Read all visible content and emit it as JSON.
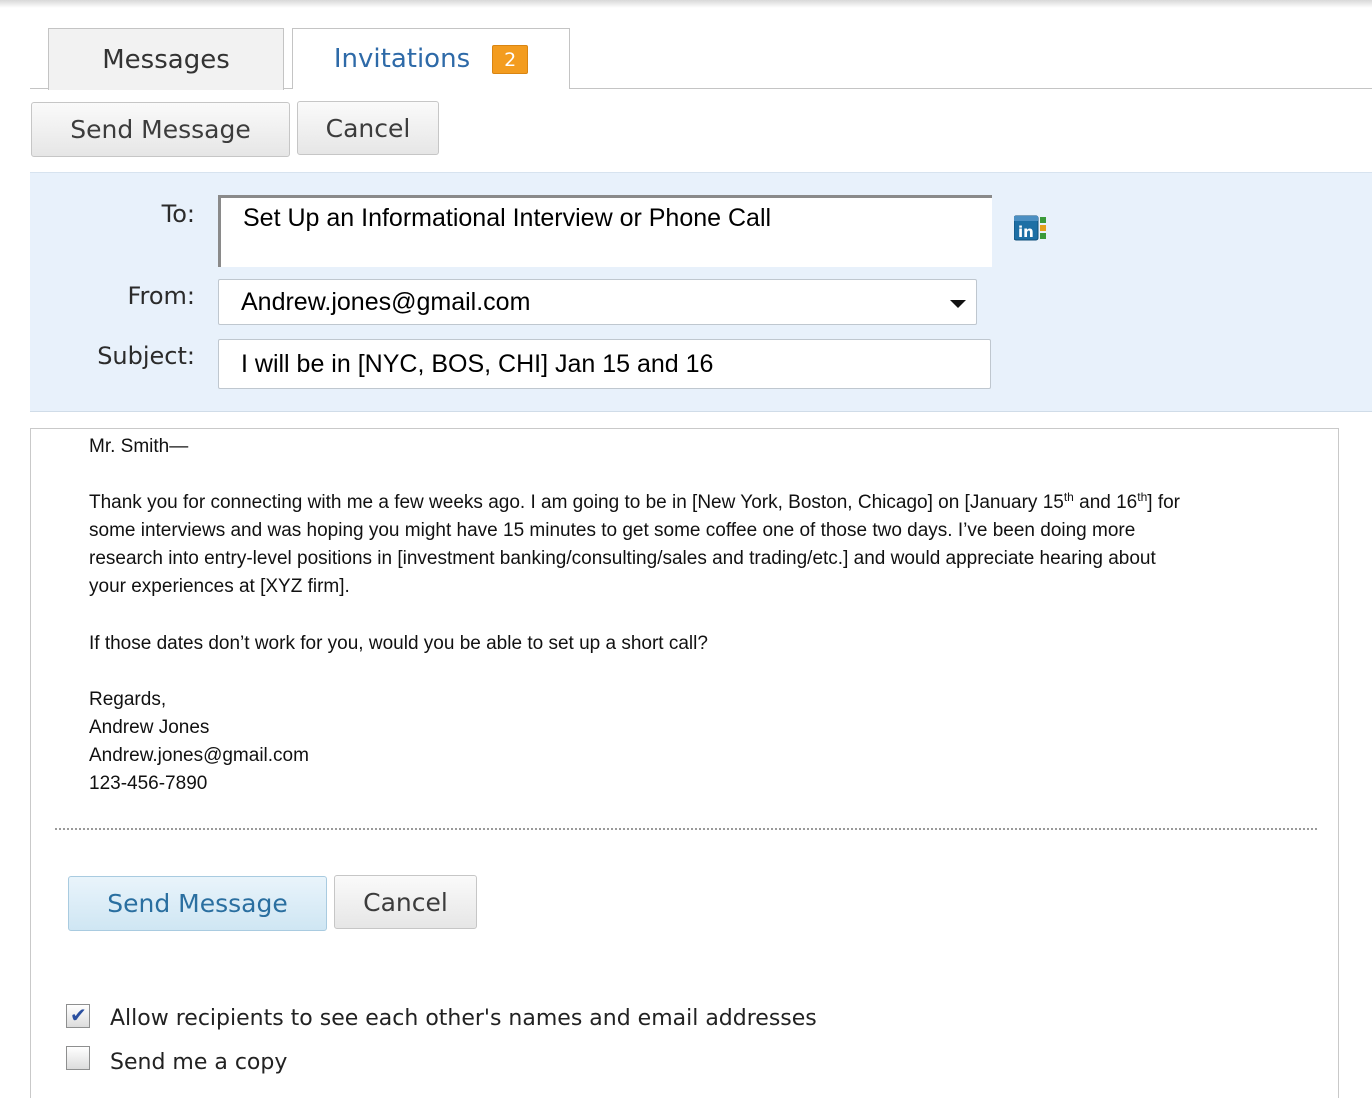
{
  "tabs": {
    "messages": "Messages",
    "invitations": "Invitations",
    "invitations_count": "2"
  },
  "toolbar": {
    "send_label": "Send Message",
    "cancel_label": "Cancel"
  },
  "form": {
    "to_label": "To:",
    "to_value": "Set Up an Informational Interview or Phone Call",
    "from_label": "From:",
    "from_value": "Andrew.jones@gmail.com",
    "subject_label": "Subject:",
    "subject_value": "I will be in [NYC, BOS, CHI] Jan 15 and 16",
    "address_book_icon": "linkedin-address-book-icon"
  },
  "message": {
    "greeting": "Mr. Smith—",
    "p1_before": "Thank you for connecting with me a few weeks ago. I am going to be in [New York, Boston, Chicago] on [January 15",
    "p1_sup1": "th",
    "p1_mid": " and 16",
    "p1_sup2": "th",
    "p1_after": "] for",
    "p1_line2": "some interviews and was hoping you might have 15 minutes to get some coffee one of those two days. I’ve been doing more",
    "p1_line3": "research into entry-level positions in [investment banking/consulting/sales and trading/etc.] and would appreciate hearing about",
    "p1_line4": "your experiences at [XYZ firm].",
    "p2": "If those dates don’t work for you, would you be able to set up a short call?",
    "signoff": "Regards,",
    "name": "Andrew Jones",
    "email": "Andrew.jones@gmail.com",
    "phone": "123-456-7890"
  },
  "footer": {
    "send_label": "Send Message",
    "cancel_label": "Cancel",
    "allow_label": "Allow recipients to see each other's names and email addresses",
    "allow_checked": true,
    "copy_label": "Send me a copy",
    "copy_checked": false
  },
  "colors": {
    "panel_bg": "#e8f1fb",
    "link_blue": "#2e6aa8",
    "badge_orange": "#f39c1f"
  }
}
